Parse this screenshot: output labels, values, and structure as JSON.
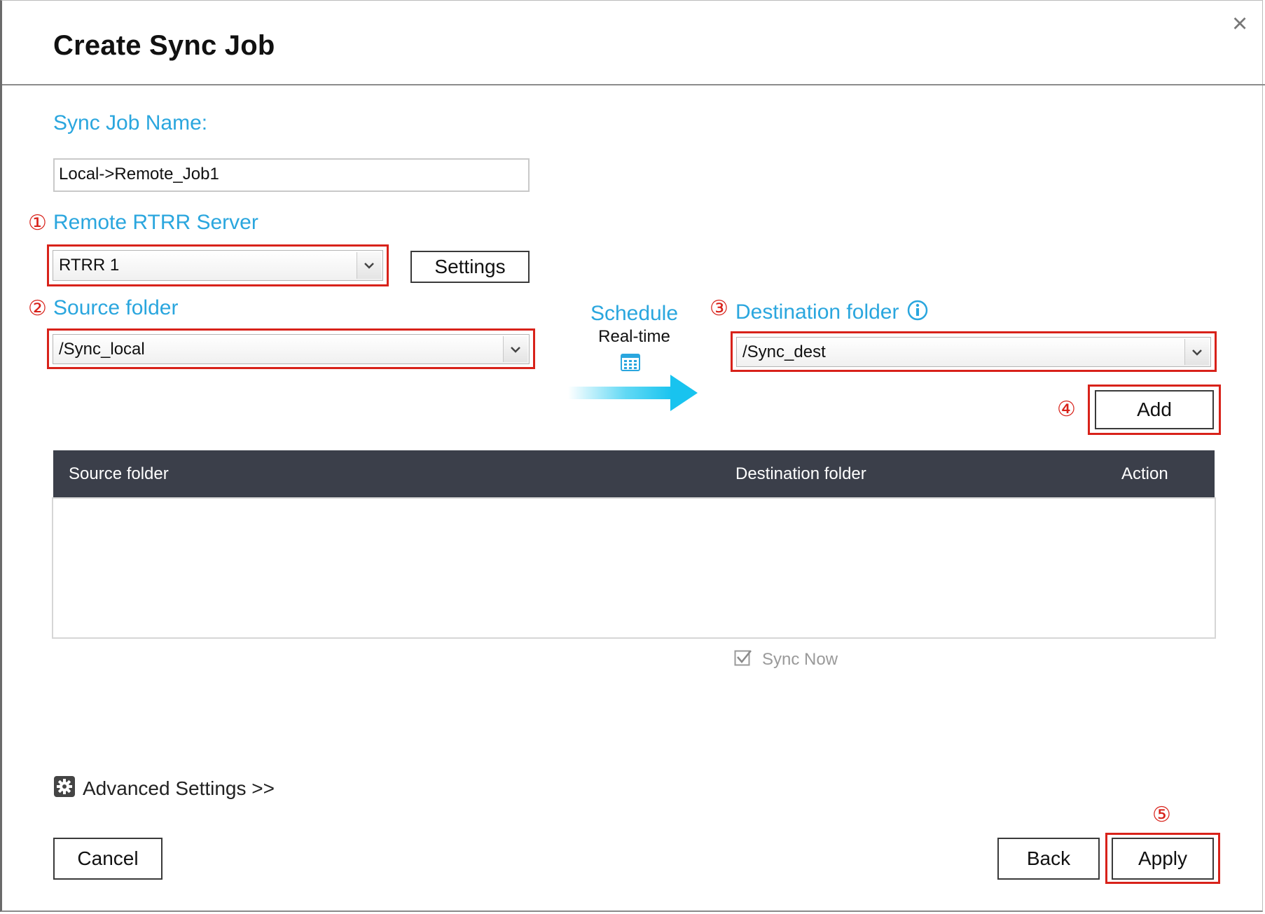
{
  "dialog": {
    "title": "Create Sync Job",
    "close_icon": "×"
  },
  "job_name": {
    "label": "Sync Job Name:",
    "value": "Local->Remote_Job1"
  },
  "remote_server": {
    "marker": "①",
    "label": "Remote RTRR Server",
    "selected": "RTRR 1",
    "settings_label": "Settings"
  },
  "source": {
    "marker": "②",
    "label": "Source folder",
    "selected": "/Sync_local"
  },
  "schedule": {
    "label": "Schedule",
    "value": "Real-time",
    "icon": "calendar-icon"
  },
  "destination": {
    "marker": "③",
    "label": "Destination folder",
    "selected": "/Sync_dest",
    "info_icon": "info-icon"
  },
  "add": {
    "marker": "④",
    "label": "Add"
  },
  "table": {
    "columns": [
      "Source folder",
      "Destination folder",
      "Action"
    ]
  },
  "sync_now": {
    "label": "Sync Now",
    "checked": true
  },
  "advanced": {
    "label": "Advanced Settings >>",
    "icon": "gear-icon"
  },
  "footer": {
    "cancel_label": "Cancel",
    "back_label": "Back",
    "apply_label": "Apply",
    "apply_marker": "⑤"
  },
  "colors": {
    "accent": "#2aa6de",
    "highlight": "#d8221a",
    "table_header": "#3b3f4a"
  }
}
